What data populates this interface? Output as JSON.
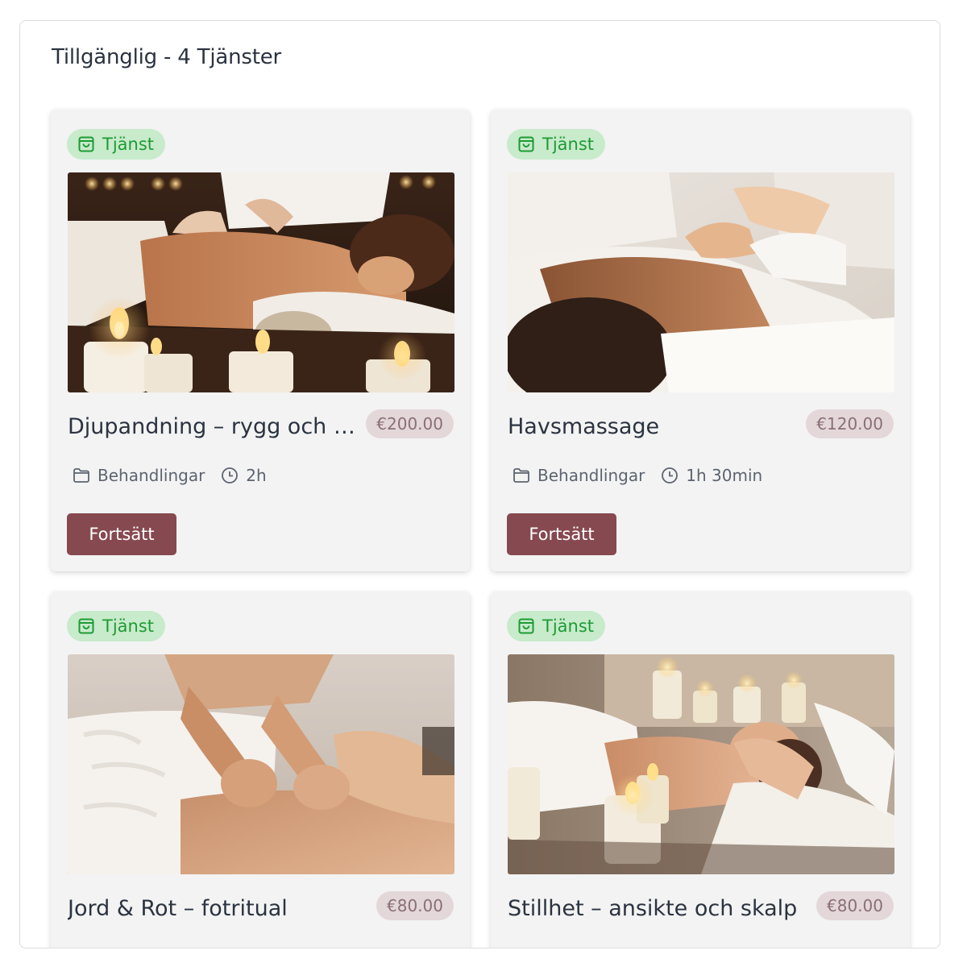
{
  "header": {
    "title": "Tillgänglig - 4 Tjänster"
  },
  "colors": {
    "badge_bg": "#c7ebcb",
    "badge_text": "#1f9a34",
    "price_bg": "#e3d7da",
    "price_text": "#8a6f76",
    "button_bg": "#86494f",
    "card_bg": "#f3f3f3"
  },
  "services": [
    {
      "badge": "Tjänst",
      "badge_icon": "shopping-bag-icon",
      "image": "back-massage-with-candles",
      "title": "Djupandning – rygg och a…",
      "price": "€200.00",
      "category_icon": "folder-icon",
      "category": "Behandlingar",
      "duration_icon": "clock-icon",
      "duration": "2h",
      "button": "Fortsätt"
    },
    {
      "badge": "Tjänst",
      "badge_icon": "shopping-bag-icon",
      "image": "shoulder-massage-towels",
      "title": "Havsmassage",
      "price": "€120.00",
      "category_icon": "folder-icon",
      "category": "Behandlingar",
      "duration_icon": "clock-icon",
      "duration": "1h 30min",
      "button": "Fortsätt"
    },
    {
      "badge": "Tjänst",
      "badge_icon": "shopping-bag-icon",
      "image": "foot-massage",
      "title": "Jord & Rot – fotritual",
      "price": "€80.00"
    },
    {
      "badge": "Tjänst",
      "badge_icon": "shopping-bag-icon",
      "image": "face-and-scalp-massage",
      "title": "Stillhet – ansikte och skalp",
      "price": "€80.00"
    }
  ]
}
